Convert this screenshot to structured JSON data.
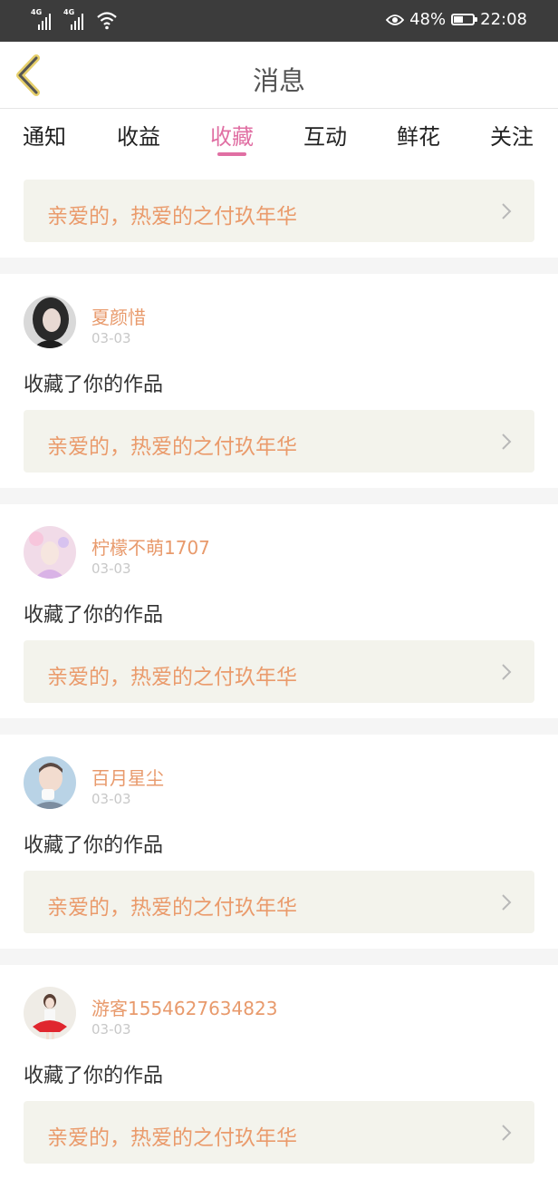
{
  "status_bar": {
    "network_1": "4G",
    "network_2": "4G",
    "battery_percent": "48%",
    "battery_level": 0.48,
    "time": "22:08"
  },
  "header": {
    "title": "消息",
    "back_icon": "chevron-left-icon"
  },
  "tabs": [
    {
      "label": "通知",
      "active": false
    },
    {
      "label": "收益",
      "active": false
    },
    {
      "label": "收藏",
      "active": true
    },
    {
      "label": "互动",
      "active": false
    },
    {
      "label": "鲜花",
      "active": false
    },
    {
      "label": "关注",
      "active": false
    }
  ],
  "colors": {
    "accent": "#e06fa3",
    "username": "#e89a6c",
    "work_title": "#ea9b6c",
    "work_box_bg": "#f3f3ec"
  },
  "first_card": {
    "work_title": "亲爱的，热爱的之付玖年华"
  },
  "items": [
    {
      "username": "夏颜惜",
      "date": "03-03",
      "action": "收藏了你的作品",
      "work_title": "亲爱的，热爱的之付玖年华"
    },
    {
      "username": "柠檬不萌1707",
      "date": "03-03",
      "action": "收藏了你的作品",
      "work_title": "亲爱的，热爱的之付玖年华"
    },
    {
      "username": "百月星尘",
      "date": "03-03",
      "action": "收藏了你的作品",
      "work_title": "亲爱的，热爱的之付玖年华"
    },
    {
      "username": "游客1554627634823",
      "date": "03-03",
      "action": "收藏了你的作品",
      "work_title": "亲爱的，热爱的之付玖年华"
    }
  ]
}
